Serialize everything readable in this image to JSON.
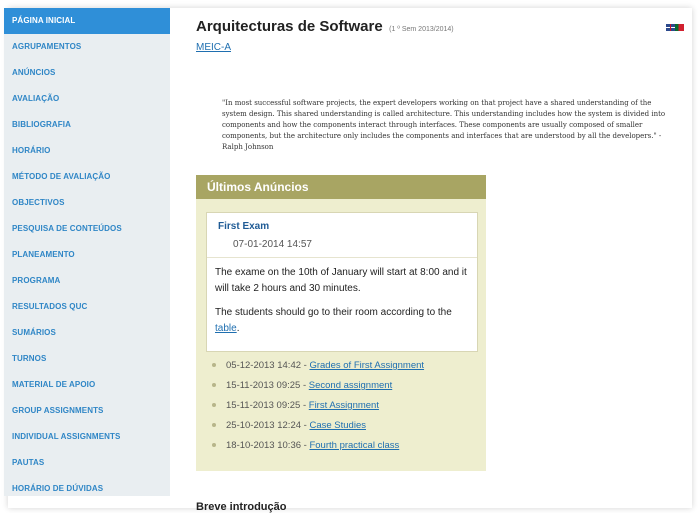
{
  "sidebar": {
    "items": [
      {
        "label": "PÁGINA INICIAL",
        "active": true
      },
      {
        "label": "AGRUPAMENTOS"
      },
      {
        "label": "ANÚNCIOS"
      },
      {
        "label": "AVALIAÇÃO"
      },
      {
        "label": "BIBLIOGRAFIA"
      },
      {
        "label": "HORÁRIO"
      },
      {
        "label": "MÉTODO DE AVALIAÇÃO"
      },
      {
        "label": "OBJECTIVOS"
      },
      {
        "label": "PESQUISA DE CONTEÚDOS"
      },
      {
        "label": "PLANEAMENTO"
      },
      {
        "label": "PROGRAMA"
      },
      {
        "label": "RESULTADOS QUC"
      },
      {
        "label": "SUMÁRIOS"
      },
      {
        "label": "TURNOS"
      },
      {
        "label": "MATERIAL DE APOIO"
      },
      {
        "label": "GROUP ASSIGNMENTS"
      },
      {
        "label": "INDIVIDUAL ASSIGNMENTS"
      },
      {
        "label": "PAUTAS"
      },
      {
        "label": "HORÁRIO DE DÚVIDAS"
      }
    ]
  },
  "header": {
    "title": "Arquitecturas de Software",
    "subtitle": "(1 º Sem 2013/2014)",
    "course_link": "MEIC-A"
  },
  "quote": "\"In most successful software projects, the expert developers working on that project have a shared understanding of the system design. This shared understanding is called architecture. This understanding includes how the system is divided into components and how the components interact through interfaces. These components are usually composed of smaller components, but the architecture only includes the components and interfaces that are understood by all the developers.\" - Ralph Johnson",
  "announcements": {
    "header": "Últimos Anúncios",
    "featured": {
      "title": "First Exam",
      "date": "07-01-2014 14:57",
      "body_1": "The exame on the 10th of January will start at 8:00 and it will take 2 hours and 30 minutes.",
      "body_2_prefix": "The students should go to their room according to the ",
      "body_2_link": "table",
      "body_2_suffix": "."
    },
    "list": [
      {
        "date": "05-12-2013 14:42",
        "title": "Grades of First Assignment"
      },
      {
        "date": "15-11-2013 09:25",
        "title": "Second assignment"
      },
      {
        "date": "15-11-2013 09:25",
        "title": "First Assignment"
      },
      {
        "date": "25-10-2013 12:24",
        "title": "Case Studies"
      },
      {
        "date": "18-10-2013 10:36",
        "title": "Fourth practical class"
      }
    ]
  },
  "section": {
    "title": "Breve introdução"
  },
  "colors": {
    "accent": "#2f8fd8",
    "sidebar_bg": "#e9eef1",
    "announce_header": "#a8a563",
    "announce_bg": "#eeeecf"
  }
}
